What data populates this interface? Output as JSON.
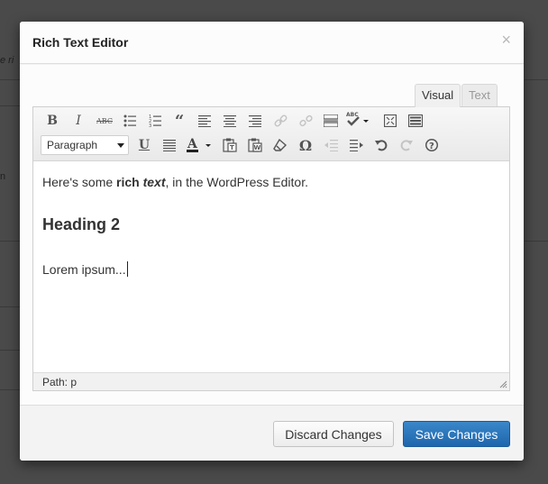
{
  "background": {
    "fragments": [
      "e ri",
      "n"
    ]
  },
  "dialog": {
    "title": "Rich Text Editor",
    "close_glyph": "×"
  },
  "editor": {
    "tabs": [
      {
        "label": "Visual",
        "active": true
      },
      {
        "label": "Text",
        "active": false
      }
    ],
    "toolbar_row1": [
      "bold-icon",
      "italic-icon",
      "strikethrough-icon",
      "bullet-list-icon",
      "numbered-list-icon",
      "blockquote-icon",
      "align-left-icon",
      "align-center-icon",
      "align-right-icon",
      "link-icon",
      "unlink-icon",
      "insert-more-icon",
      "spellcheck-icon",
      "fullscreen-icon",
      "toolbar-toggle-icon"
    ],
    "toolbar_row2": [
      "underline-icon",
      "justify-icon",
      "text-color-icon",
      "paste-text-icon",
      "paste-word-icon",
      "clear-formatting-icon",
      "special-character-icon",
      "outdent-icon",
      "indent-icon",
      "undo-icon",
      "redo-icon",
      "help-icon"
    ],
    "format_select": {
      "value": "Paragraph"
    },
    "content": {
      "p1_before": "Here's some ",
      "p1_bold": "rich",
      "p1_space": " ",
      "p1_bolditalic": "text",
      "p1_after": ", in the WordPress Editor.",
      "heading": "Heading 2",
      "p2": "Lorem ipsum..."
    },
    "path_label": "Path:",
    "path_value": "p"
  },
  "footer": {
    "discard_label": "Discard Changes",
    "save_label": "Save Changes"
  },
  "colors": {
    "primary_button": "#2a75bb"
  }
}
